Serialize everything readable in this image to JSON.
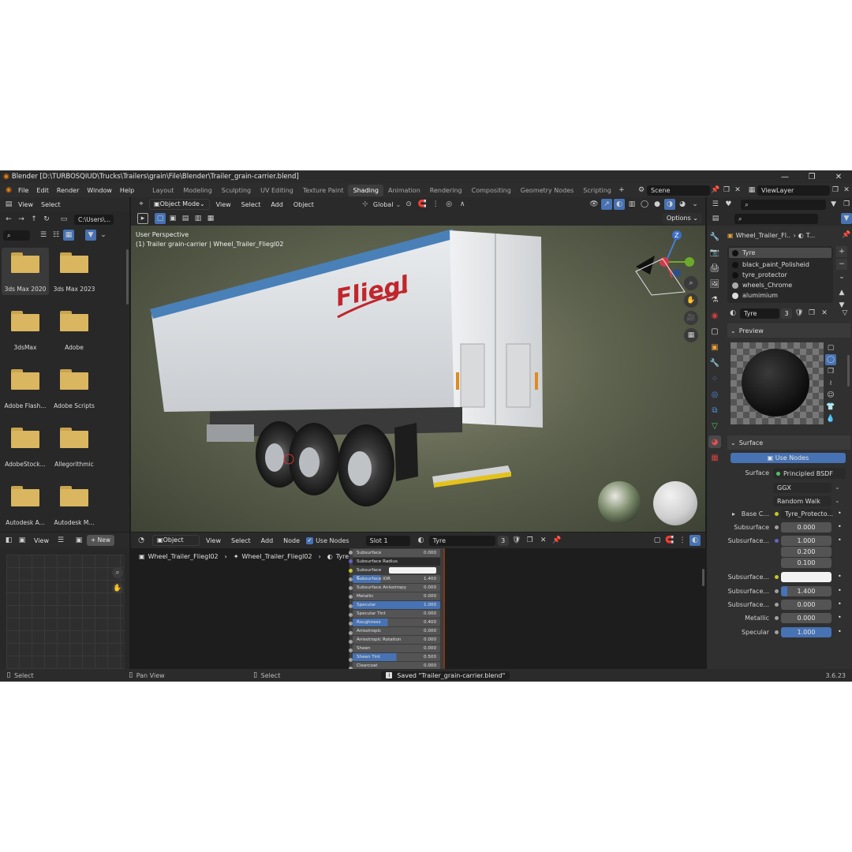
{
  "window": {
    "title": "Blender [D:\\TURBOSQIUD\\Trucks\\Trailers\\grain\\File\\Blender\\Trailer_grain-carrier.blend]",
    "controls": [
      "—",
      "❐",
      "✕"
    ]
  },
  "menu": [
    "File",
    "Edit",
    "Render",
    "Window",
    "Help"
  ],
  "workspaces": [
    {
      "label": "Layout"
    },
    {
      "label": "Modeling"
    },
    {
      "label": "Sculpting"
    },
    {
      "label": "UV Editing"
    },
    {
      "label": "Texture Paint"
    },
    {
      "label": "Shading",
      "active": true
    },
    {
      "label": "Animation"
    },
    {
      "label": "Rendering"
    },
    {
      "label": "Compositing"
    },
    {
      "label": "Geometry Nodes"
    },
    {
      "label": "Scripting"
    }
  ],
  "scene": "Scene",
  "view_layer": "ViewLayer",
  "file_browser": {
    "menus": [
      "View",
      "Select"
    ],
    "path": "C:\\Users\\...",
    "folders": [
      "3ds Max 2020",
      "3ds Max 2023",
      "3dsMax",
      "Adobe",
      "Adobe Flash...",
      "Adobe Scripts",
      "AdobeStock...",
      "Allegorithmic",
      "Autodesk A...",
      "Autodesk M..."
    ]
  },
  "viewport": {
    "mode": "Object Mode",
    "menus": [
      "View",
      "Select",
      "Add",
      "Object"
    ],
    "transform": "Global",
    "options": "Options",
    "overlay_title": "User Perspective",
    "overlay_sub": "(1) Trailer grain-carrier | Wheel_Trailer_Fliegl02",
    "brand": "Fliegl",
    "gizmo_z": "Z"
  },
  "image_editor": {
    "view": "View",
    "new": "New"
  },
  "node_editor": {
    "object": "Object",
    "menus": [
      "View",
      "Select",
      "Add",
      "Node"
    ],
    "use_nodes": "Use Nodes",
    "slot": "Slot 1",
    "material": "Tyre",
    "users": "3",
    "breadcrumb": [
      "Wheel_Trailer_Fliegl02",
      "Wheel_Trailer_Fliegl02",
      "Tyre"
    ],
    "node_rows": [
      {
        "label": "Subsurface",
        "value": "0.000"
      },
      {
        "label": "Subsurface Radius",
        "value": ""
      },
      {
        "label": "Subsurface C...",
        "value": "",
        "color": true
      },
      {
        "label": "Subsurface IOR",
        "value": "1.400",
        "fill": "32%"
      },
      {
        "label": "Subsurface Anisotropy",
        "value": "0.000"
      },
      {
        "label": "Metallic",
        "value": "0.000"
      },
      {
        "label": "Specular",
        "value": "1.000",
        "fill": "100%"
      },
      {
        "label": "Specular Tint",
        "value": "0.000"
      },
      {
        "label": "Roughness",
        "value": "0.400",
        "fill": "40%"
      },
      {
        "label": "Anisotropic",
        "value": "0.000"
      },
      {
        "label": "Anisotropic Rotation",
        "value": "0.000"
      },
      {
        "label": "Sheen",
        "value": "0.000"
      },
      {
        "label": "Sheen Tint",
        "value": "0.500",
        "fill": "50%"
      },
      {
        "label": "Clearcoat",
        "value": "0.000"
      }
    ]
  },
  "properties": {
    "object": "Wheel_Trailer_Fl...",
    "object_tail": "T...",
    "materials": [
      "Tyre",
      "black_paint_Polisheid",
      "tyre_protector",
      "wheels_Chrome",
      "alumimium"
    ],
    "material": "Tyre",
    "users": "3",
    "preview": "Preview",
    "surface_section": "Surface",
    "use_nodes": "Use Nodes",
    "surface_label": "Surface",
    "surface_value": "Principled BSDF",
    "distribution": "GGX",
    "subsurface_method": "Random Walk",
    "base_color_label": "Base C...",
    "base_color_value": "Tyre_Protecto...",
    "subsurface_label": "Subsurface",
    "subsurface_value": "0.000",
    "radius_label": "Subsurface...",
    "radius_values": [
      "1.000",
      "0.200",
      "0.100"
    ],
    "sss_color_label": "Subsurface...",
    "sss_ior_label": "Subsurface...",
    "sss_ior_value": "1.400",
    "sss_aniso_label": "Subsurface...",
    "sss_aniso_value": "0.000",
    "metallic_label": "Metallic",
    "metallic_value": "0.000",
    "specular_label": "Specular",
    "specular_value": "1.000"
  },
  "status": {
    "left": "Select",
    "mid": "Pan View",
    "right": "Select",
    "message": "Saved \"Trailer_grain-carrier.blend\"",
    "version": "3.6.23"
  },
  "colors": {
    "accent": "#4772b3",
    "folder": "#d9b65f"
  }
}
